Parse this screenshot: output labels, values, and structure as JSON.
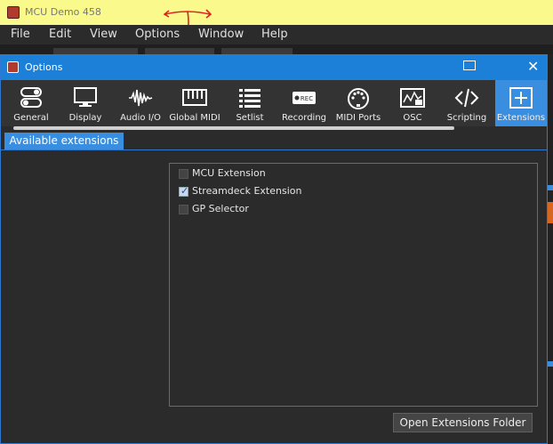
{
  "app": {
    "title": "MCU Demo 458"
  },
  "menu": [
    "File",
    "Edit",
    "View",
    "Options",
    "Window",
    "Help"
  ],
  "dialog": {
    "title": "Options",
    "toolbar": [
      {
        "label": "General",
        "icon": "toggle-icon"
      },
      {
        "label": "Display",
        "icon": "monitor-icon"
      },
      {
        "label": "Audio I/O",
        "icon": "waveform-icon"
      },
      {
        "label": "Global MIDI",
        "icon": "keyboard-icon"
      },
      {
        "label": "Setlist",
        "icon": "list-icon"
      },
      {
        "label": "Recording",
        "icon": "rec-icon",
        "badge": "REC"
      },
      {
        "label": "MIDI Ports",
        "icon": "midi-port-icon"
      },
      {
        "label": "OSC",
        "icon": "osc-icon"
      },
      {
        "label": "Scripting",
        "icon": "code-icon"
      },
      {
        "label": "Extensions",
        "icon": "plus-box-icon",
        "active": true
      }
    ],
    "tab": "Available extensions",
    "extensions": [
      {
        "label": "MCU Extension",
        "checked": false
      },
      {
        "label": "Streamdeck Extension",
        "checked": true
      },
      {
        "label": "GP Selector",
        "checked": false
      }
    ],
    "open_button": "Open Extensions Folder"
  },
  "colors": {
    "accent": "#3a8ee0",
    "titlebar": "#fafa8c",
    "annotation": "#e02020"
  }
}
